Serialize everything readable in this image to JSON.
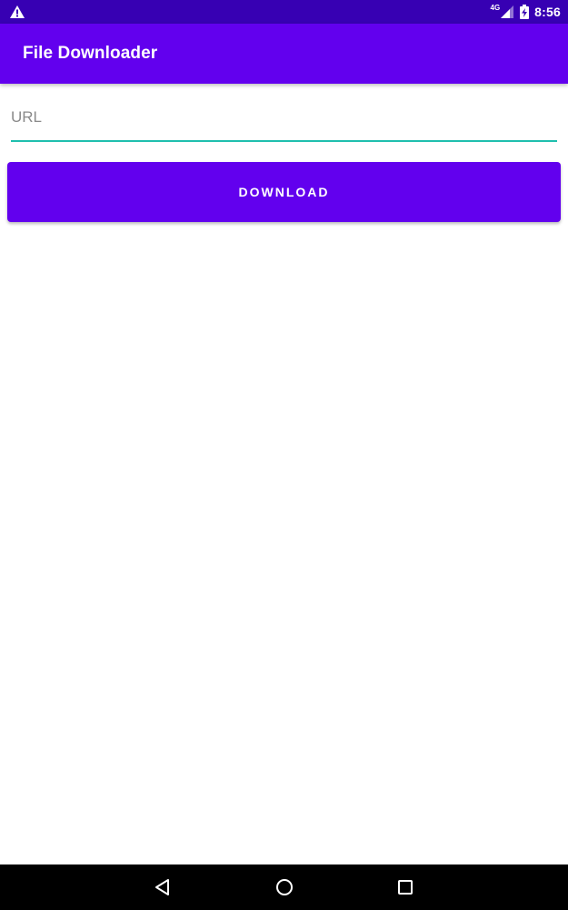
{
  "status_bar": {
    "network_label": "4G",
    "time": "8:56",
    "icons": [
      "warning-icon",
      "signal-icon",
      "battery-icon"
    ]
  },
  "app_bar": {
    "title": "File Downloader"
  },
  "url_input": {
    "placeholder": "URL",
    "value": ""
  },
  "download_button": {
    "label": "DOWNLOAD"
  },
  "nav_bar": {
    "icons": [
      "back-icon",
      "home-icon",
      "recents-icon"
    ]
  },
  "colors": {
    "status_bar": "#3700b3",
    "primary": "#6200ee",
    "accent_underline": "#1fbfae",
    "nav_bar": "#000000"
  }
}
